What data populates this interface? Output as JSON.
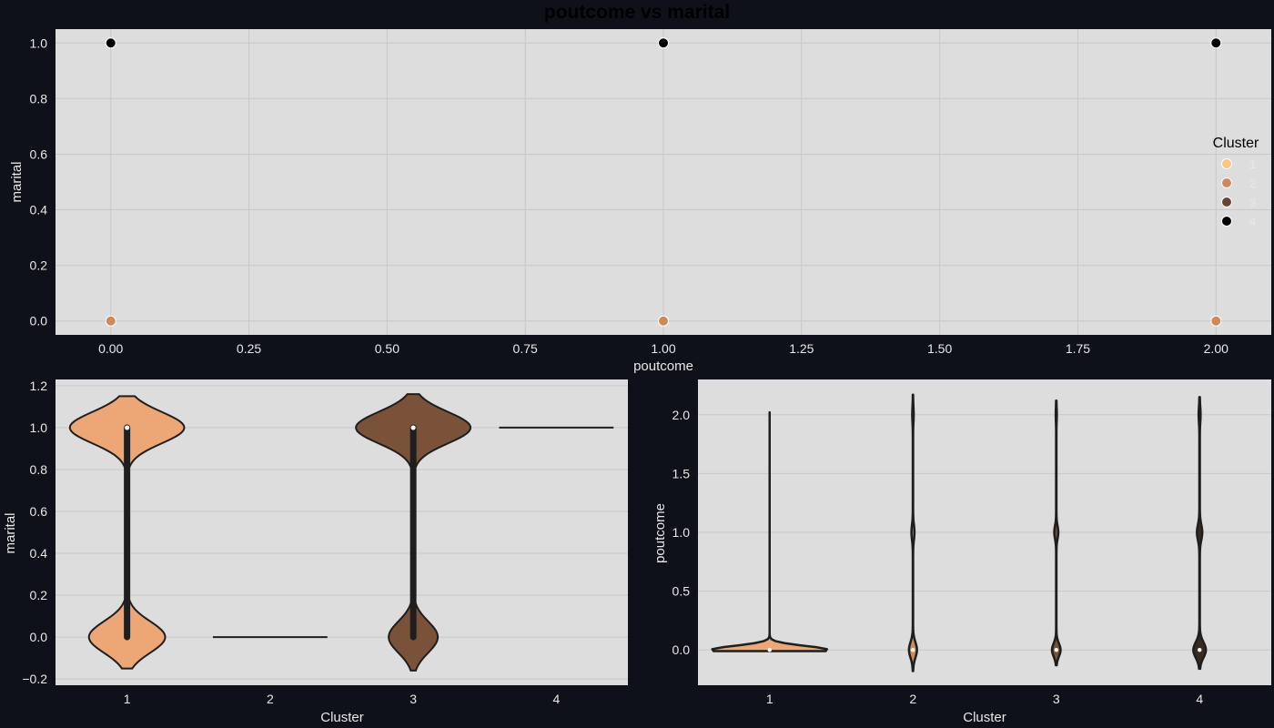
{
  "figure_title": "poutcome vs marital",
  "colors": {
    "background": "#0e111a",
    "panel": "#dddddd",
    "grid": "#c8c8c8",
    "text": "#e8e8e8",
    "cluster_1": "#f9c686",
    "cluster_2": "#cf8a5c",
    "cluster_3": "#6b4530",
    "cluster_4": "#000000",
    "violin_1": "#eda676",
    "violin_2": "#cf8a5c",
    "violin_3": "#7a5239",
    "violin_4": "#3a2a22",
    "stroke": "#1e1e1e"
  },
  "chart_data": [
    {
      "type": "scatter",
      "title": "poutcome vs marital",
      "xlabel": "poutcome",
      "ylabel": "marital",
      "xlim": [
        -0.1,
        2.1
      ],
      "ylim": [
        -0.05,
        1.05
      ],
      "xticks": [
        "0.00",
        "0.25",
        "0.50",
        "0.75",
        "1.00",
        "1.25",
        "1.50",
        "1.75",
        "2.00"
      ],
      "yticks": [
        "0.0",
        "0.2",
        "0.4",
        "0.6",
        "0.8",
        "1.0"
      ],
      "grid": true,
      "legend": {
        "title": "Cluster",
        "placement": "right",
        "entries": [
          "1",
          "2",
          "3",
          "4"
        ]
      },
      "series": [
        {
          "name": "1",
          "x": [],
          "y": []
        },
        {
          "name": "2",
          "x": [
            0,
            1,
            2
          ],
          "y": [
            0,
            0,
            0
          ]
        },
        {
          "name": "3",
          "x": [],
          "y": []
        },
        {
          "name": "4",
          "x": [
            0,
            1,
            2
          ],
          "y": [
            1,
            1,
            1
          ]
        }
      ]
    },
    {
      "type": "violin",
      "xlabel": "Cluster",
      "ylabel": "marital",
      "categories": [
        "1",
        "2",
        "3",
        "4"
      ],
      "ylim": [
        -0.23,
        1.23
      ],
      "yticks": [
        "−0.2",
        "0.0",
        "0.2",
        "0.4",
        "0.6",
        "0.8",
        "1.0",
        "1.2"
      ],
      "grid": true,
      "violins": [
        {
          "category": "1",
          "min": -0.15,
          "max": 1.15,
          "median": 1.0,
          "q1": 0.0,
          "q3": 1.0,
          "modes": [
            0,
            1
          ],
          "mode_weights": [
            0.4,
            0.6
          ]
        },
        {
          "category": "2",
          "constant": 0.0
        },
        {
          "category": "3",
          "min": -0.16,
          "max": 1.16,
          "median": 1.0,
          "q1": 0.0,
          "q3": 1.0,
          "modes": [
            0,
            1
          ],
          "mode_weights": [
            0.3,
            0.7
          ]
        },
        {
          "category": "4",
          "constant": 1.0
        }
      ]
    },
    {
      "type": "violin",
      "xlabel": "Cluster",
      "ylabel": "poutcome",
      "categories": [
        "1",
        "2",
        "3",
        "4"
      ],
      "ylim": [
        -0.3,
        2.3
      ],
      "yticks": [
        "0.0",
        "0.5",
        "1.0",
        "1.5",
        "2.0"
      ],
      "grid": true,
      "violins": [
        {
          "category": "1",
          "min": -0.01,
          "max": 2.02,
          "median": 0.0
        },
        {
          "category": "2",
          "min": -0.18,
          "max": 2.17,
          "median": 0.0
        },
        {
          "category": "3",
          "min": -0.13,
          "max": 2.12,
          "median": 0.0
        },
        {
          "category": "4",
          "min": -0.16,
          "max": 2.15,
          "median": 0.0
        }
      ]
    }
  ]
}
